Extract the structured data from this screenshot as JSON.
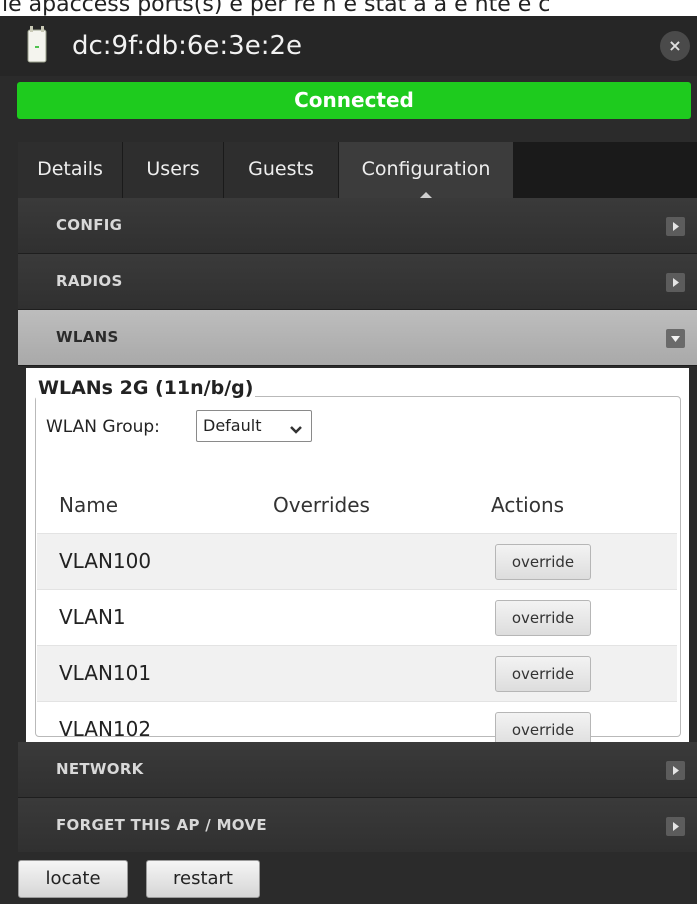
{
  "top_clip_text": "ie apaccess ports(s) e per re n e stat a a e nte e c",
  "header": {
    "device_name": "dc:9f:db:6e:3e:2e",
    "close_glyph": "×",
    "status": "Connected",
    "status_color": "#1ecb1e"
  },
  "tabs": [
    {
      "label": "Details"
    },
    {
      "label": "Users"
    },
    {
      "label": "Guests"
    },
    {
      "label": "Configuration",
      "active": true
    }
  ],
  "sections": {
    "config": "CONFIG",
    "radios": "RADIOS",
    "wlans": "WLANS",
    "network": "NETWORK",
    "forget": "FORGET THIS AP / MOVE"
  },
  "wlans": {
    "legend": "WLANs 2G (11n/b/g)",
    "group_label": "WLAN Group:",
    "group_value": "Default",
    "columns": [
      "Name",
      "Overrides",
      "Actions"
    ],
    "rows": [
      {
        "name": "VLAN100",
        "overrides": "",
        "action": "override"
      },
      {
        "name": "VLAN1",
        "overrides": "",
        "action": "override"
      },
      {
        "name": "VLAN101",
        "overrides": "",
        "action": "override"
      },
      {
        "name": "VLAN102",
        "overrides": "",
        "action": "override"
      }
    ]
  },
  "footer": {
    "locate": "locate",
    "restart": "restart"
  },
  "icons": {
    "ap": "access-point-icon",
    "close": "close-icon",
    "collapsed": "triangle-right-icon",
    "expanded": "triangle-down-icon",
    "select": "chevron-down-icon"
  }
}
